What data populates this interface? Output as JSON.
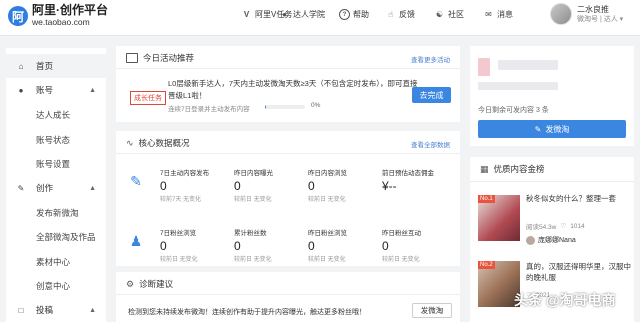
{
  "header": {
    "logo_title": "阿里·创作平台",
    "logo_url": "we.taobao.com",
    "nav": [
      {
        "icon": "v-icon",
        "label": "阿里V任务"
      },
      {
        "icon": "person-icon",
        "label": "达人学院"
      },
      {
        "icon": "help-icon",
        "label": "帮助"
      },
      {
        "icon": "thumbs-up-icon",
        "label": "反馈"
      },
      {
        "icon": "community-icon",
        "label": "社区"
      },
      {
        "icon": "mail-icon",
        "label": "消息"
      }
    ],
    "user_name": "二水良推",
    "user_role": "微淘号 | 达人 ▾"
  },
  "sidebar": {
    "items": [
      {
        "label": "首页",
        "icon": "home-icon"
      },
      {
        "label": "账号",
        "icon": "account-icon",
        "arrow": "▲"
      },
      {
        "label": "达人成长"
      },
      {
        "label": "账号状态"
      },
      {
        "label": "账号设置"
      },
      {
        "label": "创作",
        "icon": "create-icon",
        "arrow": "▲"
      },
      {
        "label": "发布新微淘"
      },
      {
        "label": "全部微淘及作品"
      },
      {
        "label": "素材中心"
      },
      {
        "label": "创意中心"
      },
      {
        "label": "投稿",
        "icon": "submit-icon",
        "arrow": "▲"
      }
    ]
  },
  "today_card": {
    "title": "今日活动推荐",
    "link": "查看更多活动",
    "tag": "成长任务",
    "desc": "L0层级新手达人，7天内主动发微淘天数≥3天（不包含定时发布），即可直接晋级L1啦！",
    "sub": "连续7日登录并主动发布内容",
    "progress_text": "0%",
    "progress": 0.02,
    "button": "去完成"
  },
  "data_card": {
    "title": "核心数据概况",
    "link": "查看全部数据",
    "metrics_row1": [
      {
        "label": "7日主动内容发布",
        "value": "0",
        "sub": "较前7天 无变化"
      },
      {
        "label": "昨日内容曝光",
        "value": "0",
        "sub": "较前日 无变化"
      },
      {
        "label": "昨日内容浏览",
        "value": "0",
        "sub": "较前日 无变化"
      },
      {
        "label": "前日预估动态佣金",
        "value": "¥--",
        "sub": ""
      }
    ],
    "metrics_row2": [
      {
        "label": "7日粉丝浏览",
        "value": "0",
        "sub": "较前日 无变化"
      },
      {
        "label": "累计粉丝数",
        "value": "0",
        "sub": "较前日 无变化"
      },
      {
        "label": "昨日粉丝浏览",
        "value": "0",
        "sub": "较前日 无变化"
      },
      {
        "label": "昨日粉丝互动",
        "value": "0",
        "sub": "较前日 无变化"
      }
    ]
  },
  "diag_card": {
    "title": "诊断建议",
    "text": "检测到您未持续发布微淘！连续创作有助于提升内容曝光，触达更多粉丝哦！",
    "button": "发微淘"
  },
  "right_top": {
    "remaining": "今日剩余可发内容 3 条",
    "button": "发微淘"
  },
  "quality": {
    "title": "优质内容金榜",
    "posts": [
      {
        "rank": "No.1",
        "title": "秋冬似女的什么？整理一套",
        "views": "阅读54.3w",
        "likes": "1014",
        "author": "庞娜娜Nana"
      },
      {
        "rank": "No.2",
        "title": "真的，汉服还得明华里，汉服中的晚礼服",
        "views": "",
        "likes": "3021",
        "author": ""
      }
    ]
  },
  "watermark": "头条 @淘哥电商"
}
